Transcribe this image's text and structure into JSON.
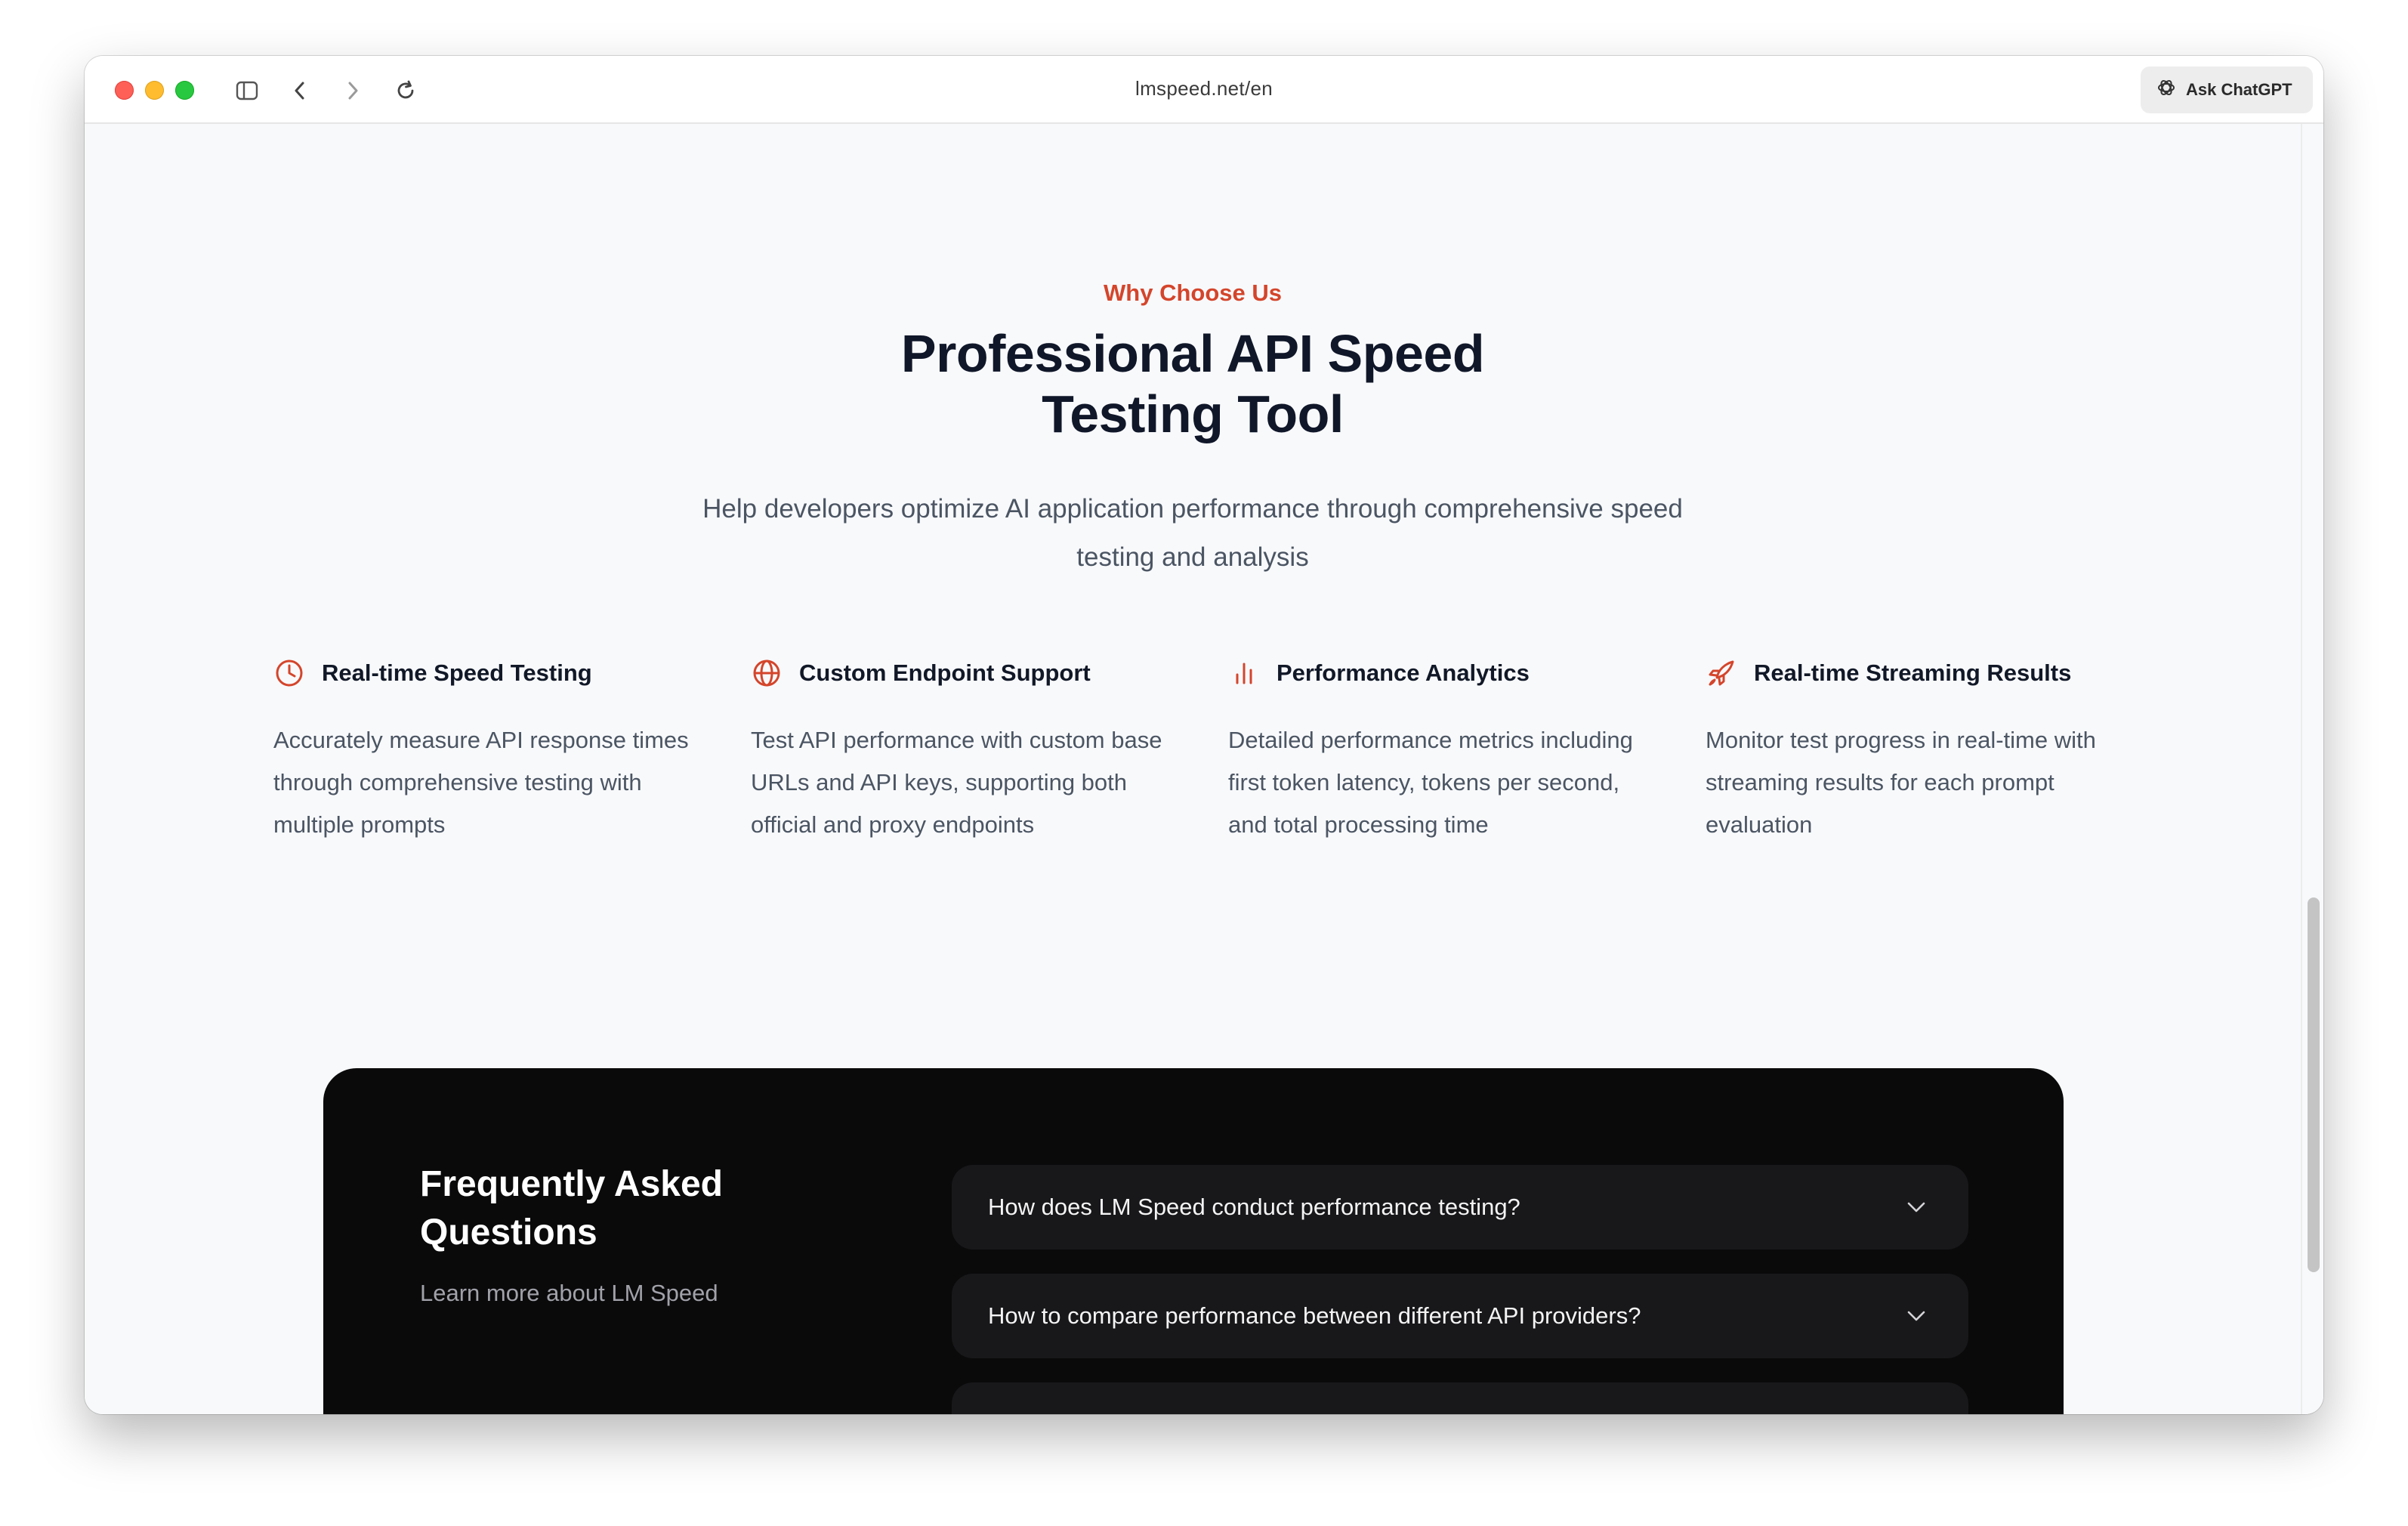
{
  "browser": {
    "url": "lmspeed.net/en",
    "ask_button_label": "Ask ChatGPT",
    "icons": [
      "sidebar-toggle-icon",
      "back-arrow-icon",
      "forward-arrow-icon",
      "reload-icon",
      "chatgpt-icon"
    ]
  },
  "hero": {
    "eyebrow": "Why Choose Us",
    "heading": "Professional API Speed Testing Tool",
    "subheading": "Help developers optimize AI application performance through comprehensive speed testing and analysis"
  },
  "features": [
    {
      "icon": "clock-icon",
      "title": "Real-time Speed Testing",
      "description": "Accurately measure API response times through comprehensive testing with multiple prompts"
    },
    {
      "icon": "globe-icon",
      "title": "Custom Endpoint Support",
      "description": "Test API performance with custom base URLs and API keys, supporting both official and proxy endpoints"
    },
    {
      "icon": "bar-chart-icon",
      "title": "Performance Analytics",
      "description": "Detailed performance metrics including first token latency, tokens per second, and total processing time"
    },
    {
      "icon": "rocket-icon",
      "title": "Real-time Streaming Results",
      "description": "Monitor test progress in real-time with streaming results for each prompt evaluation"
    }
  ],
  "faq": {
    "title": "Frequently Asked Questions",
    "subtitle": "Learn more about LM Speed",
    "questions": [
      "How does LM Speed conduct performance testing?",
      "How to compare performance between different API providers?",
      ""
    ]
  },
  "colors": {
    "accent": "#d4452b",
    "heading": "#101729",
    "body_text": "#4b5563",
    "page_background": "#f8f9fb",
    "faq_background": "#0a0a0b",
    "faq_item_background": "#18181b"
  }
}
